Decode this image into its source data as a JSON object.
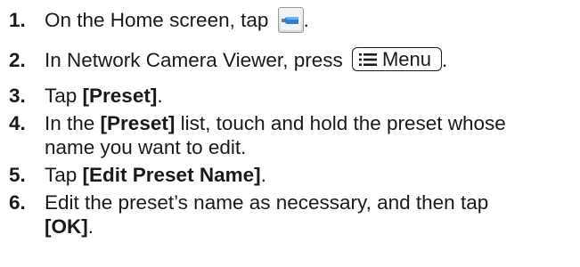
{
  "steps": [
    {
      "number": "1.",
      "text_before": "On the Home screen, tap",
      "text_after": ".",
      "icon": "network-camera-viewer-app-icon"
    },
    {
      "number": "2.",
      "text_before": "In Network Camera Viewer, press",
      "key_label": "Menu",
      "key_icon": "menu-list-icon",
      "text_after": "."
    },
    {
      "number": "3.",
      "text_before": "Tap ",
      "bold": "[Preset]",
      "text_after": "."
    },
    {
      "number": "4.",
      "text_before": "In the ",
      "bold": "[Preset]",
      "text_after": " list, touch and hold the preset whose",
      "line2": "name you want to edit."
    },
    {
      "number": "5.",
      "text_before": "Tap ",
      "bold": "[Edit Preset Name]",
      "text_after": "."
    },
    {
      "number": "6.",
      "text_before": "Edit the preset’s name as necessary, and then tap",
      "line2_bold": "[OK]",
      "line2_after": "."
    }
  ],
  "colors": {
    "text": "#1a1a1a",
    "icon_blue": "#2f7fd0"
  }
}
